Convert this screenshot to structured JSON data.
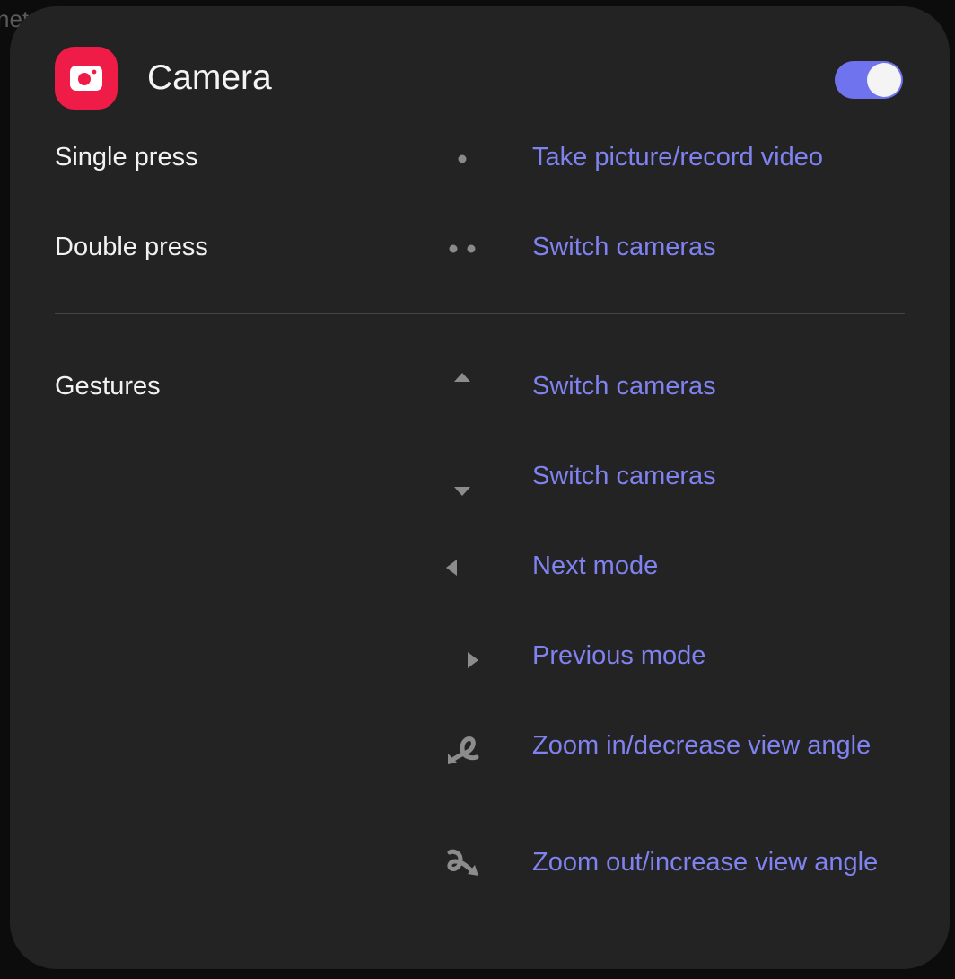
{
  "backdrop": {
    "partial_text": "net"
  },
  "header": {
    "app_name": "Camera",
    "toggle_on": true,
    "accent_color": "#6f74ee",
    "icon_color": "#ef1c48"
  },
  "presses": [
    {
      "label": "Single press",
      "icon": "single-dot-icon",
      "action": "Take picture/record video"
    },
    {
      "label": "Double press",
      "icon": "double-dot-icon",
      "action": "Switch cameras"
    }
  ],
  "gestures": {
    "label": "Gestures",
    "items": [
      {
        "icon": "arrow-up-icon",
        "action": "Switch cameras"
      },
      {
        "icon": "arrow-down-icon",
        "action": "Switch cameras"
      },
      {
        "icon": "arrow-left-icon",
        "action": "Next mode"
      },
      {
        "icon": "arrow-right-icon",
        "action": "Previous mode"
      },
      {
        "icon": "loop-counterclockwise-icon",
        "action": "Zoom in/decrease view angle"
      },
      {
        "icon": "loop-clockwise-icon",
        "action": "Zoom out/increase view angle"
      }
    ]
  }
}
